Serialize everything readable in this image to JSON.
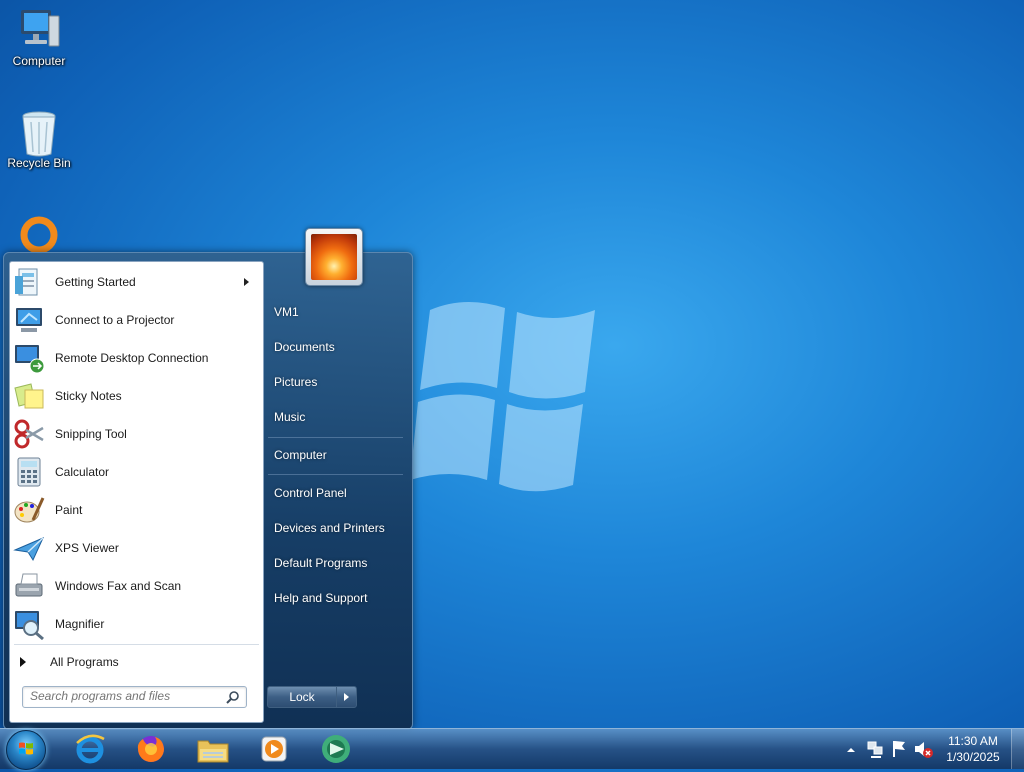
{
  "desktop": {
    "icons": [
      {
        "label": "Computer",
        "icon": "computer-icon"
      },
      {
        "label": "Recycle Bin",
        "icon": "recycle-bin-icon"
      },
      {
        "label": "",
        "icon": "app-shortcut-icon"
      }
    ]
  },
  "start_menu": {
    "programs": [
      {
        "label": "Getting Started",
        "icon": "getting-started-icon",
        "has_submenu": true
      },
      {
        "label": "Connect to a Projector",
        "icon": "projector-icon"
      },
      {
        "label": "Remote Desktop Connection",
        "icon": "remote-desktop-icon"
      },
      {
        "label": "Sticky Notes",
        "icon": "sticky-notes-icon"
      },
      {
        "label": "Snipping Tool",
        "icon": "snipping-tool-icon"
      },
      {
        "label": "Calculator",
        "icon": "calculator-icon"
      },
      {
        "label": "Paint",
        "icon": "paint-icon"
      },
      {
        "label": "XPS Viewer",
        "icon": "xps-viewer-icon"
      },
      {
        "label": "Windows Fax and Scan",
        "icon": "fax-scan-icon"
      },
      {
        "label": "Magnifier",
        "icon": "magnifier-icon"
      }
    ],
    "all_programs": "All Programs",
    "search_placeholder": "Search programs and files",
    "right_items": [
      {
        "label": "VM1"
      },
      {
        "label": "Documents"
      },
      {
        "label": "Pictures"
      },
      {
        "label": "Music"
      },
      {
        "label": "Computer"
      },
      {
        "label": "Control Panel"
      },
      {
        "label": "Devices and Printers"
      },
      {
        "label": "Default Programs"
      },
      {
        "label": "Help and Support"
      }
    ],
    "power_button": "Lock"
  },
  "taskbar": {
    "apps": [
      "internet-explorer-icon",
      "firefox-icon",
      "file-explorer-icon",
      "media-player-icon",
      "app-icon"
    ],
    "tray_icons": [
      "show-hidden-icons-chevron",
      "network-icon",
      "action-center-flag-icon",
      "volume-muted-icon"
    ],
    "clock_time": "11:30 AM",
    "clock_date": "1/30/2025"
  }
}
